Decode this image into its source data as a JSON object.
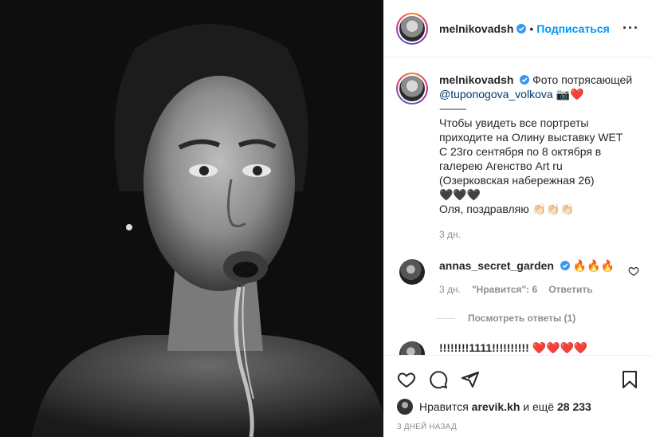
{
  "post": {
    "username": "melnikovadsh",
    "dot": "•",
    "follow_label": "Подписаться",
    "more_label": "···"
  },
  "caption": {
    "username": "melnikovadsh",
    "text_start": "Фото потрясающей",
    "mention": "@tuponogova_volkova",
    "emoji_after_mention": "📷❤️",
    "dash": "⸻",
    "lines": [
      "Чтобы увидеть все портреты",
      "приходите на Олину выставку WET",
      "С 23го сентября по 8 октября в",
      "галерею Агенство Art ru",
      "(Озерковская набережная 26)",
      "🖤🖤🖤",
      "Оля, поздравляю 👏🏻👏🏻👏🏻"
    ],
    "time": "3 дн."
  },
  "comments": [
    {
      "username": "annas_secret_garden",
      "text": "🔥🔥🔥",
      "time": "3 дн.",
      "likes": "\"Нравится\": 6",
      "reply_label": "Ответить",
      "view_replies": "Посмотреть ответы (1)"
    },
    {
      "username": "!!!!!!!!1111!!!!!!!!!!",
      "text": "❤️❤️❤️❤️"
    }
  ],
  "footer": {
    "liked_prefix": "Нравится",
    "liked_user": "arevik.kh",
    "liked_mid": "и ещё",
    "liked_count": "28 233",
    "timestamp": "3 ДНЕЙ НАЗАД"
  },
  "colors": {
    "accent": "#0095f6",
    "verified": "#3897f0",
    "muted": "#8e8e8e"
  }
}
